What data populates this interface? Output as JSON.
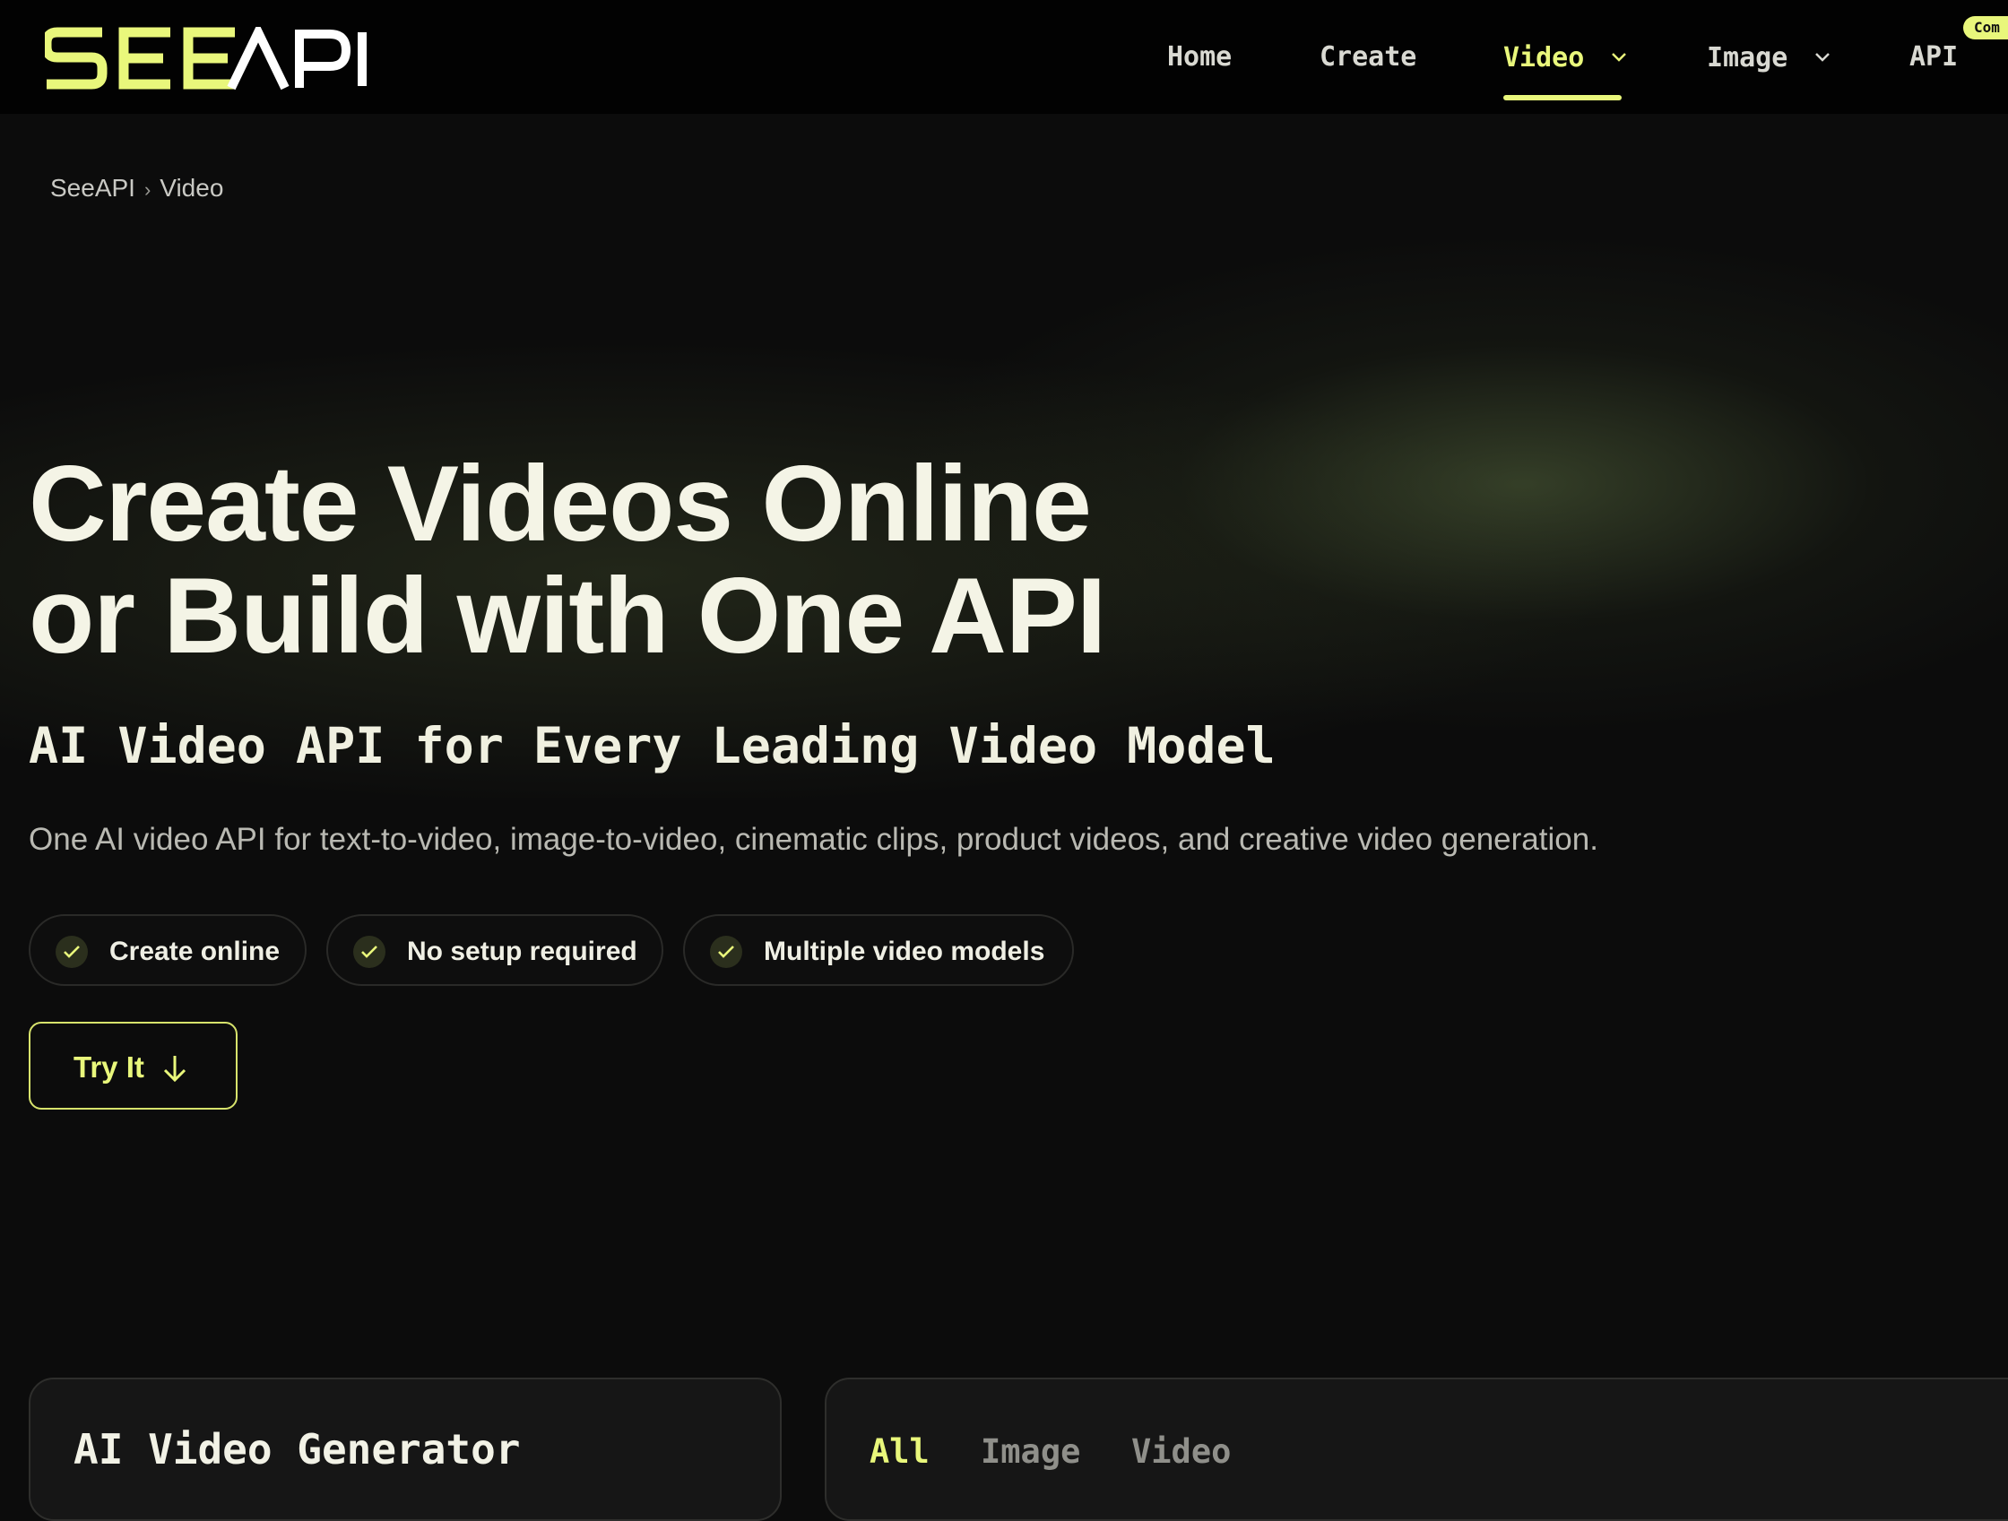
{
  "header": {
    "logo_text": "SEEAPI",
    "nav": [
      {
        "label": "Home",
        "has_dropdown": false,
        "active": false
      },
      {
        "label": "Create",
        "has_dropdown": false,
        "active": false
      },
      {
        "label": "Video",
        "has_dropdown": true,
        "active": true
      },
      {
        "label": "Image",
        "has_dropdown": true,
        "active": false
      },
      {
        "label": "API",
        "has_dropdown": false,
        "active": false
      }
    ],
    "badge": "Com"
  },
  "breadcrumb": {
    "items": [
      "SeeAPI",
      "Video"
    ],
    "separator": "›"
  },
  "hero": {
    "title_line1": "Create Videos Online",
    "title_line2": "or Build with One API",
    "subtitle": "AI Video API for Every Leading Video Model",
    "description": "One AI video API for text-to-video, image-to-video, cinematic clips, product videos, and creative video generation.",
    "features": [
      "Create online",
      "No setup required",
      "Multiple video models"
    ],
    "cta_label": "Try It"
  },
  "generator_panel": {
    "title": "AI Video Generator"
  },
  "filter_tabs": {
    "tabs": [
      "All",
      "Image",
      "Video"
    ],
    "active_index": 0
  },
  "colors": {
    "accent": "#e9f77b",
    "background": "#0c0c0c",
    "header_bg": "#020202",
    "panel_bg": "#161616"
  },
  "icons": {
    "dropdown": "chevron-down-icon",
    "feature": "check-icon",
    "cta": "arrow-down-icon",
    "breadcrumb_separator": "chevron-right-icon"
  }
}
